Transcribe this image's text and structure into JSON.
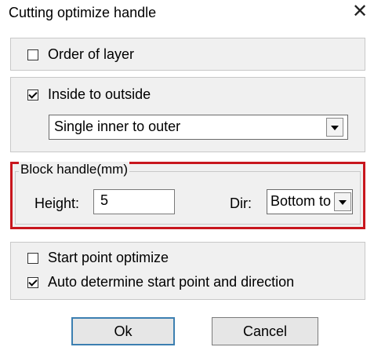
{
  "dialog": {
    "title": "Cutting optimize handle",
    "close_glyph": "✕",
    "close_icon": "close-icon"
  },
  "order_of_layer": {
    "label": "Order of layer",
    "checked": false
  },
  "inside_to_outside": {
    "label": "Inside to outside",
    "checked": true,
    "select_value": "Single inner to outer"
  },
  "block_handle": {
    "legend": "Block handle(mm)",
    "height_label": "Height:",
    "height_value": "5",
    "dir_label": "Dir:",
    "dir_value": "Bottom to",
    "highlight_color": "#c8161d"
  },
  "start_point_optimize": {
    "label": "Start point optimize",
    "checked": false
  },
  "auto_determine": {
    "label": "Auto determine start point and direction",
    "checked": true
  },
  "buttons": {
    "ok": "Ok",
    "cancel": "Cancel"
  }
}
